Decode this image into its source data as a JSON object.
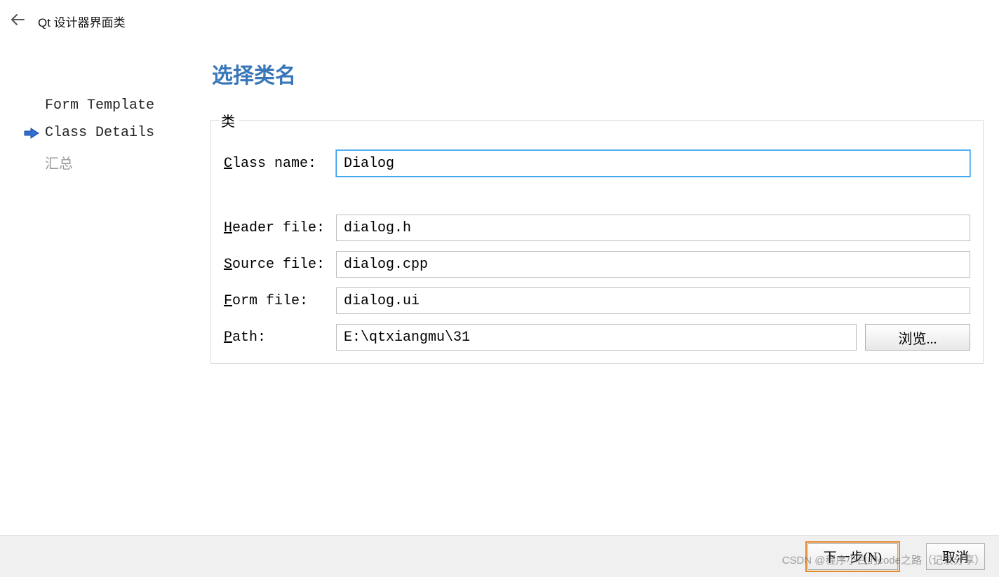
{
  "header": {
    "title": "Qt 设计器界面类"
  },
  "sidebar": {
    "steps": [
      {
        "label": "Form Template"
      },
      {
        "label": "Class Details"
      },
      {
        "label": "汇总"
      }
    ]
  },
  "content": {
    "section_title": "选择类名",
    "group_legend": "类",
    "labels": {
      "class_name": "Class name:",
      "header_file": "Header file:",
      "source_file": "Source file:",
      "form_file": "Form file:",
      "path": "Path:"
    },
    "values": {
      "class_name": "Dialog",
      "header_file": "dialog.h",
      "source_file": "dialog.cpp",
      "form_file": "dialog.ui",
      "path": "E:\\qtxiangmu\\31"
    },
    "browse_label": "浏览..."
  },
  "footer": {
    "next_label": "下一步(N)",
    "cancel_label": "取消"
  },
  "watermark": "CSDN @程序小白的code之路（记录分享）"
}
